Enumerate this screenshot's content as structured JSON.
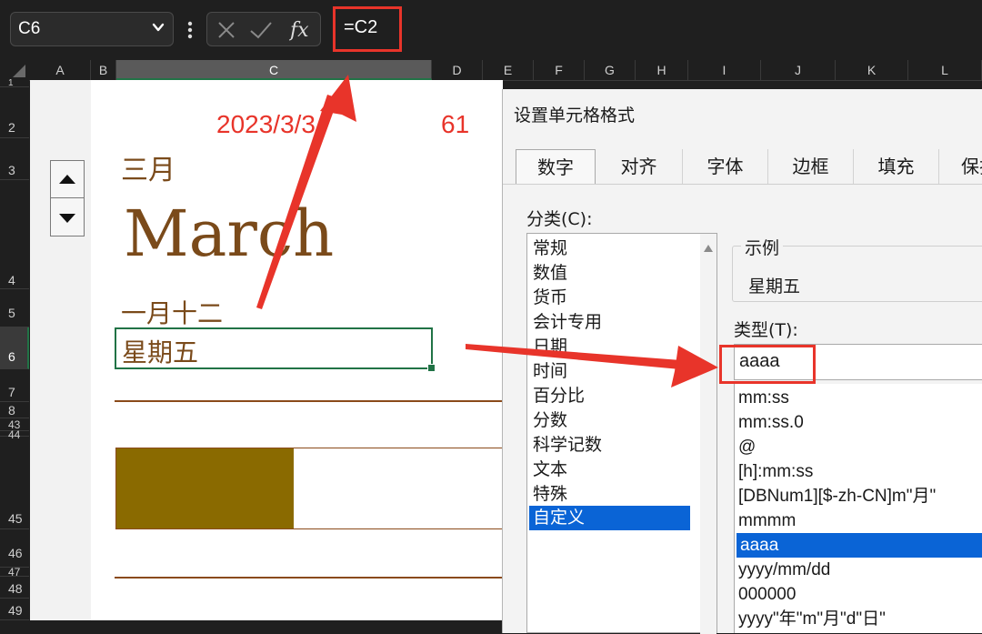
{
  "formula_bar": {
    "name_box": "C6",
    "formula": "=C2"
  },
  "columns": [
    "A",
    "B",
    "C",
    "D",
    "E",
    "F",
    "G",
    "H",
    "I",
    "J",
    "K",
    "L"
  ],
  "rows": [
    "1",
    "2",
    "3",
    "4",
    "5",
    "6",
    "7",
    "8",
    "43",
    "44",
    "45",
    "46",
    "47",
    "48",
    "49"
  ],
  "sheet": {
    "date": "2023/3/3",
    "days": "61",
    "month_cn": "三月",
    "month_en": "March",
    "lunar": "一月十二",
    "weekday": "星期五",
    "progress": 0.46
  },
  "dialog": {
    "title": "设置单元格格式",
    "tabs": [
      "数字",
      "对齐",
      "字体",
      "边框",
      "填充",
      "保护"
    ],
    "category_label": "分类(C):",
    "categories": [
      "常规",
      "数值",
      "货币",
      "会计专用",
      "日期",
      "时间",
      "百分比",
      "分数",
      "科学记数",
      "文本",
      "特殊",
      "自定义"
    ],
    "selected_category": "自定义",
    "sample_label": "示例",
    "sample_value": "星期五",
    "type_label": "类型(T):",
    "type_value": "aaaa",
    "formats": [
      "mm:ss",
      "mm:ss.0",
      "@",
      "[h]:mm:ss",
      "[DBNum1][$-zh-CN]m\"月\"",
      "mmmm",
      "aaaa",
      "yyyy/mm/dd",
      "000000",
      "yyyy\"年\"m\"月\"d\"日\""
    ],
    "selected_format": "aaaa"
  },
  "colors": {
    "annotation": "#e8342a",
    "selection": "#0a64d6",
    "brown": "#7a4a1a",
    "bar": "#8a6a00",
    "excel_green": "#217346"
  }
}
